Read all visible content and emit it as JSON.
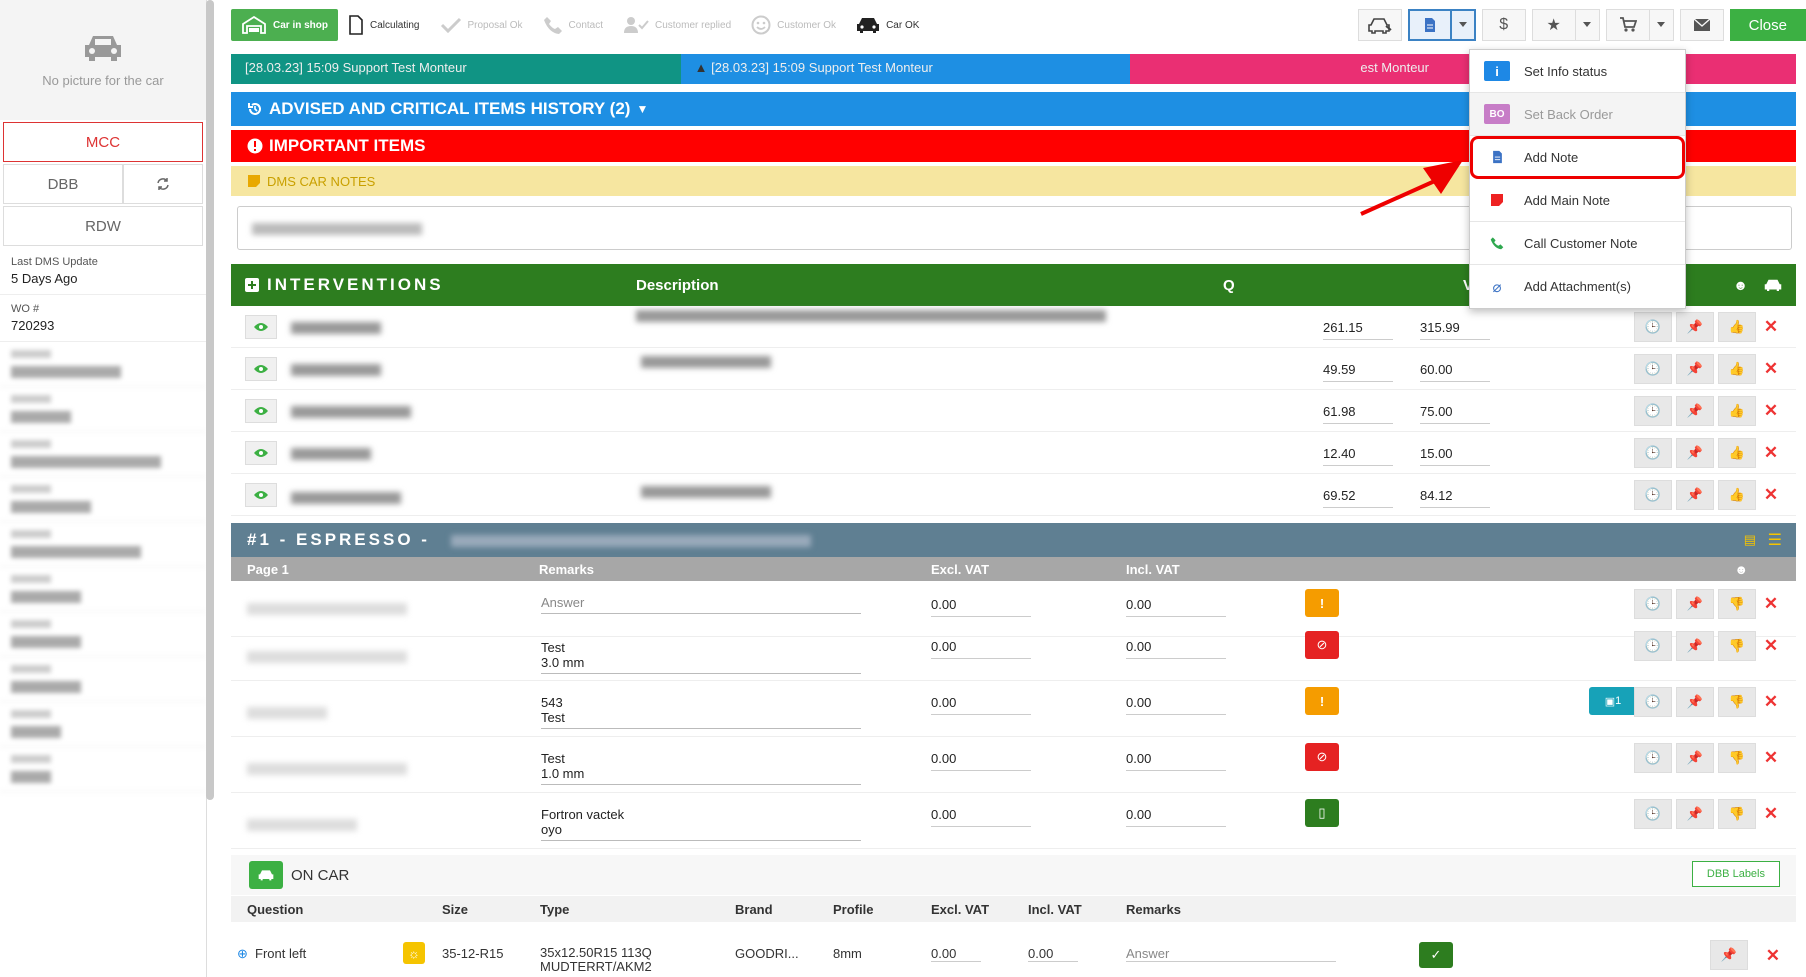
{
  "sidebar": {
    "no_picture": "No picture for the car",
    "mcc": "MCC",
    "dbb": "DBB",
    "rdw": "RDW",
    "last_dms_label": "Last DMS Update",
    "last_dms_value": "5 Days Ago",
    "wo_label": "WO #",
    "wo_value": "720293"
  },
  "steps": [
    {
      "label": "Car in shop",
      "state": "active"
    },
    {
      "label": "Calculating",
      "state": "done"
    },
    {
      "label": "Proposal Ok",
      "state": "pending"
    },
    {
      "label": "Contact",
      "state": "pending"
    },
    {
      "label": "Customer replied",
      "state": "pending"
    },
    {
      "label": "Customer Ok",
      "state": "pending"
    },
    {
      "label": "Car OK",
      "state": "done"
    }
  ],
  "toolbar": {
    "close": "Close"
  },
  "notes": [
    {
      "date": "[28.03.23] 15:09",
      "text": "Support Test Monteur"
    },
    {
      "date": "[28.03.23] 15:09",
      "text": "Support Test Monteur"
    },
    {
      "date": "",
      "text": "est Monteur"
    }
  ],
  "bands": {
    "history": "ADVISED AND CRITICAL ITEMS HISTORY (2)",
    "important": "IMPORTANT ITEMS",
    "dms_notes": "DMS CAR NOTES"
  },
  "interventions": {
    "title": "INTERVENTIONS",
    "col_description": "Description",
    "col_q": "Q",
    "col_vat": "VAT",
    "rows": [
      {
        "excl": "261.15",
        "incl": "315.99"
      },
      {
        "excl": "49.59",
        "incl": "60.00"
      },
      {
        "excl": "61.98",
        "incl": "75.00"
      },
      {
        "excl": "12.40",
        "incl": "15.00"
      },
      {
        "excl": "69.52",
        "incl": "84.12"
      }
    ]
  },
  "espresso": {
    "title": "#1 - ESPRESSO -",
    "col_page": "Page 1",
    "col_remarks": "Remarks",
    "col_excl": "Excl. VAT",
    "col_incl": "Incl. VAT",
    "rows": [
      {
        "remark1": "Answer",
        "remark2": "",
        "placeholder": true,
        "excl": "0.00",
        "incl": "0.00",
        "status": "warning"
      },
      {
        "remark1": "Test",
        "remark2": "3.0 mm",
        "placeholder": false,
        "excl": "0.00",
        "incl": "0.00",
        "status": "blocked"
      },
      {
        "remark1": "543",
        "remark2": "Test",
        "placeholder": false,
        "excl": "0.00",
        "incl": "0.00",
        "status": "warning",
        "photos": "1"
      },
      {
        "remark1": "Test",
        "remark2": "1.0 mm",
        "placeholder": false,
        "excl": "0.00",
        "incl": "0.00",
        "status": "blocked"
      },
      {
        "remark1": "Fortron vactek",
        "remark2": "oyo",
        "placeholder": false,
        "excl": "0.00",
        "incl": "0.00",
        "status": "doc"
      }
    ]
  },
  "oncar": {
    "title": "ON CAR",
    "dbb_labels": "DBB Labels",
    "cols": [
      "Question",
      "Size",
      "Type",
      "Brand",
      "Profile",
      "Excl. VAT",
      "Incl. VAT",
      "Remarks"
    ],
    "row": {
      "question": "Front left",
      "size": "35-12-R15",
      "type1": "35x12.50R15 113Q",
      "type2": "MUDTERRT/AKM2",
      "brand": "GOODRI...",
      "profile": "8mm",
      "excl": "0.00",
      "incl": "0.00",
      "remarks_placeholder": "Answer"
    }
  },
  "menu": [
    {
      "badge": "i",
      "label": "Set Info status",
      "color": "#1e88e5"
    },
    {
      "badge": "BO",
      "label": "Set Back Order",
      "color": "#c77dc7"
    },
    {
      "badge": "doc",
      "label": "Add Note",
      "color": "#3b72c4"
    },
    {
      "badge": "doc",
      "label": "Add Main Note",
      "color": "#e22"
    },
    {
      "badge": "phone",
      "label": "Call Customer Note",
      "color": "#2fa84f"
    },
    {
      "badge": "clip",
      "label": "Add Attachment(s)",
      "color": "#3b72c4"
    }
  ]
}
